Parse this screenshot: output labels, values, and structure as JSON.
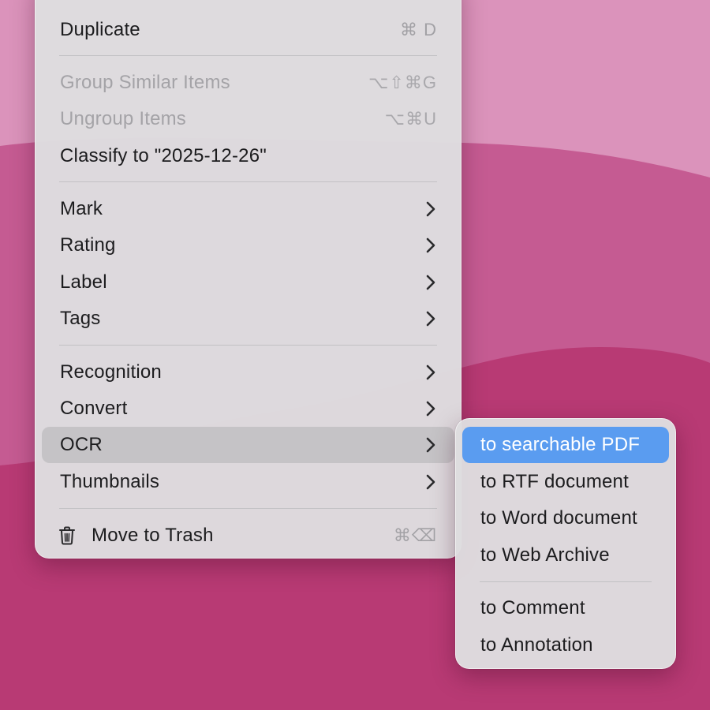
{
  "main_menu": {
    "items": [
      {
        "label": "Duplicate",
        "shortcut": "⌘ D"
      },
      {
        "label": "Group Similar Items",
        "shortcut": "⌥⇧⌘G",
        "disabled": true
      },
      {
        "label": "Ungroup Items",
        "shortcut": "⌥⌘U",
        "disabled": true
      },
      {
        "label": "Classify to \"2025-12-26\""
      },
      {
        "label": "Mark",
        "submenu": true
      },
      {
        "label": "Rating",
        "submenu": true
      },
      {
        "label": "Label",
        "submenu": true
      },
      {
        "label": "Tags",
        "submenu": true
      },
      {
        "label": "Recognition",
        "submenu": true
      },
      {
        "label": "Convert",
        "submenu": true
      },
      {
        "label": "OCR",
        "submenu": true,
        "highlighted": true
      },
      {
        "label": "Thumbnails",
        "submenu": true
      },
      {
        "label": "Move to Trash",
        "shortcut": "⌘⌫",
        "icon": "trash-icon"
      }
    ]
  },
  "ocr_submenu": {
    "items": [
      {
        "label": "to searchable PDF",
        "selected": true
      },
      {
        "label": "to RTF document"
      },
      {
        "label": "to Word document"
      },
      {
        "label": "to Web Archive"
      },
      {
        "label": "to Comment"
      },
      {
        "label": "to Annotation"
      }
    ]
  },
  "colors": {
    "selection_blue": "#5a9cf0",
    "hover_gray": "#c5c3c6",
    "wallpaper_pink": "#b83a74"
  }
}
